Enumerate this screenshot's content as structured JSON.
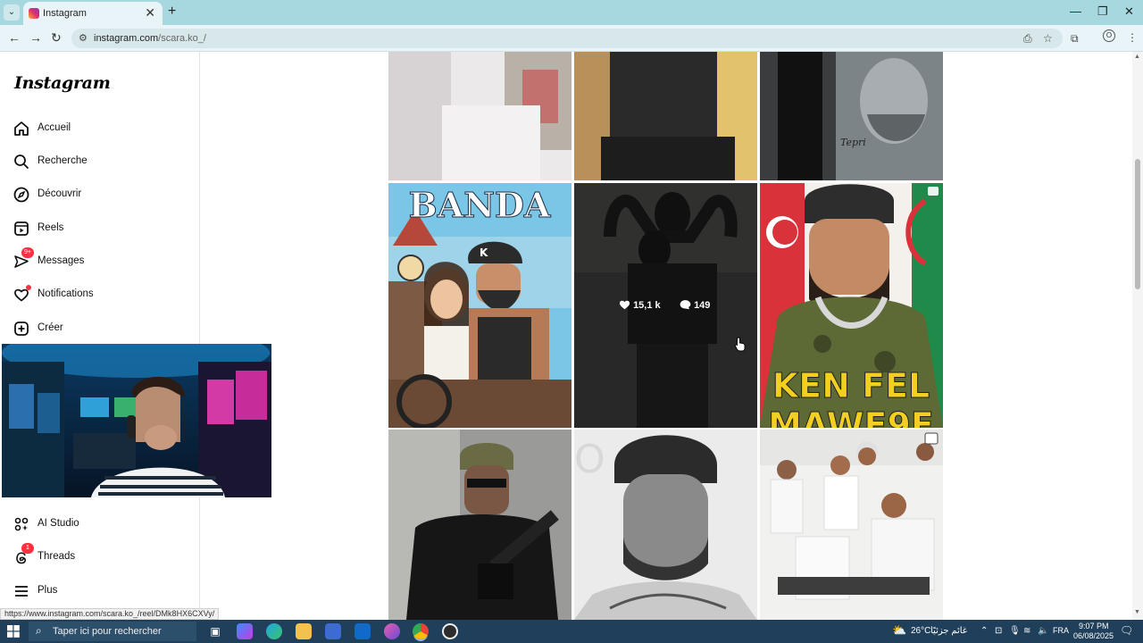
{
  "browser": {
    "tab_title": "Instagram",
    "url_domain": "instagram.com",
    "url_path": "/scara.ko_/",
    "new_tab_symbol": "+",
    "close_symbol": "✕",
    "profile_initial": "O"
  },
  "sidebar": {
    "logo": "Instagram",
    "items": [
      {
        "label": "Accueil",
        "icon": "home-icon"
      },
      {
        "label": "Recherche",
        "icon": "search-icon"
      },
      {
        "label": "Découvrir",
        "icon": "compass-icon"
      },
      {
        "label": "Reels",
        "icon": "reels-icon"
      },
      {
        "label": "Messages",
        "icon": "messenger-icon",
        "badge": "9+"
      },
      {
        "label": "Notifications",
        "icon": "heart-icon",
        "dot": true
      },
      {
        "label": "Créer",
        "icon": "plus-square-icon"
      },
      {
        "label": "AI Studio",
        "icon": "ai-studio-icon"
      },
      {
        "label": "Threads",
        "icon": "threads-icon",
        "badge": "1"
      },
      {
        "label": "Plus",
        "icon": "menu-icon"
      }
    ]
  },
  "grid": {
    "hover_likes": "15,1 k",
    "hover_comments": "149",
    "tile1_text": "BANDA",
    "tile1_cap_letter": "K",
    "tile2_text": "KEN FEL",
    "tile2_text2": "MAWE9E",
    "tile3_text": "O",
    "signature_text": "Tepri"
  },
  "status_url": "https://www.instagram.com/scara.ko_/reel/DMk8HX6CXVy/",
  "taskbar": {
    "search_placeholder": "Taper ici pour rechercher",
    "weather_temp": "26°C",
    "weather_text": "غائم جزئيًا",
    "language": "FRA",
    "time": "9:07 PM",
    "date": "06/08/2025"
  },
  "colors": {
    "tab_bar": "#a7d8e0",
    "badge": "#ff3040",
    "taskbar": "#1f3f5a"
  }
}
